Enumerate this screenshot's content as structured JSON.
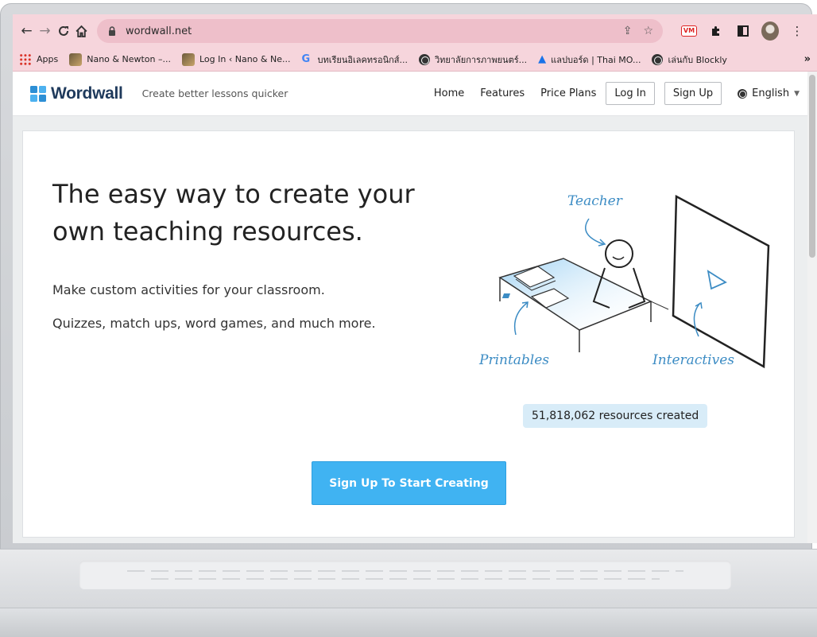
{
  "browser": {
    "url": "wordwall.net",
    "bookmarks": [
      {
        "label": "Apps",
        "icon": "apps-grid-icon"
      },
      {
        "label": "Nano & Newton –...",
        "icon": "site-thumbnail-icon"
      },
      {
        "label": "Log In ‹ Nano & Ne...",
        "icon": "site-thumbnail-icon"
      },
      {
        "label": "บทเรียนอิเลคทรอนิกส์...",
        "icon": "google-icon"
      },
      {
        "label": "วิทยาลัยการภาพยนตร์...",
        "icon": "globe-icon"
      },
      {
        "label": "แลปบอร์ด | Thai MO...",
        "icon": "flask-icon"
      },
      {
        "label": "เล่นกับ Blockly",
        "icon": "globe-icon"
      }
    ],
    "more_bookmarks": "»",
    "extension_badge": "VM"
  },
  "header": {
    "logo_text": "Wordwall",
    "tagline": "Create better lessons quicker",
    "nav": [
      "Home",
      "Features",
      "Price Plans"
    ],
    "login_label": "Log In",
    "signup_label": "Sign Up",
    "language_label": "English"
  },
  "hero": {
    "title": "The easy way to create your own teaching resources.",
    "subtitle_1": "Make custom activities for your classroom.",
    "subtitle_2": "Quizzes, match ups, word games, and much more.",
    "illustration_labels": {
      "teacher": "Teacher",
      "printables": "Printables",
      "interactives": "Interactives"
    },
    "resources_count": "51,818,062 resources created",
    "cta_label": "Sign Up To Start Creating"
  },
  "colors": {
    "toolbar_bg": "#f6d5dc",
    "cta_bg": "#40b3f2",
    "counter_bg": "#d8ecf8",
    "illustration_blue": "#3c8cc4",
    "logo_text": "#1f3a5c"
  }
}
